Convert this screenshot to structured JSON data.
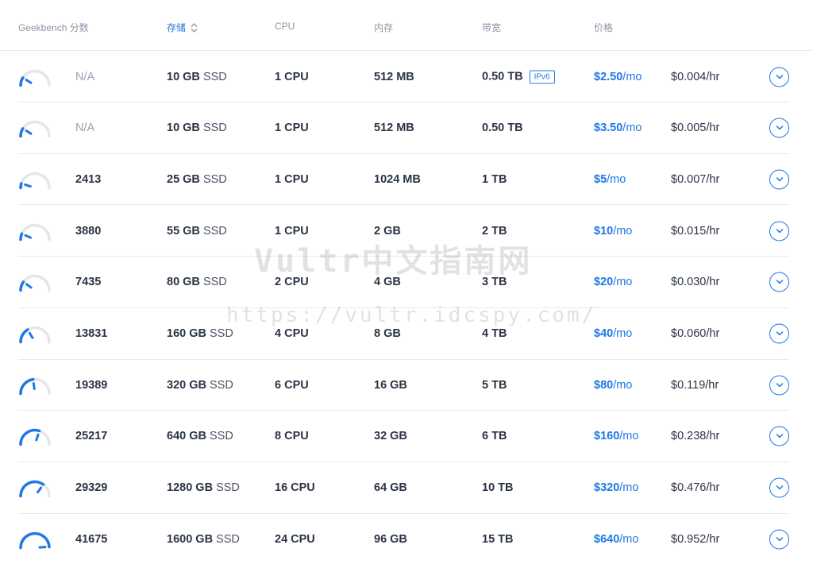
{
  "colors": {
    "accent": "#1e78e6",
    "text": "#2b3445",
    "muted": "#8a93a3",
    "gauge_track": "#e3e6eb"
  },
  "table": {
    "headers": {
      "geekbench": "Geekbench 分数",
      "storage": "存储",
      "cpu": "CPU",
      "memory": "内存",
      "bandwidth": "带宽",
      "price": "价格"
    },
    "sorted_column": "storage",
    "rows": [
      {
        "gauge_level": 0.18,
        "score": "N/A",
        "storage_num": "10 GB",
        "storage_unit": "SSD",
        "cpu": "1 CPU",
        "memory": "512 MB",
        "bandwidth": "0.50 TB",
        "tag": "IPv6",
        "price_value": "$2.50",
        "price_unit": "/mo",
        "hourly": "$0.004/hr"
      },
      {
        "gauge_level": 0.18,
        "score": "N/A",
        "storage_num": "10 GB",
        "storage_unit": "SSD",
        "cpu": "1 CPU",
        "memory": "512 MB",
        "bandwidth": "0.50 TB",
        "tag": "",
        "price_value": "$3.50",
        "price_unit": "/mo",
        "hourly": "$0.005/hr"
      },
      {
        "gauge_level": 0.1,
        "score": "2413",
        "storage_num": "25 GB",
        "storage_unit": "SSD",
        "cpu": "1 CPU",
        "memory": "1024 MB",
        "bandwidth": "1 TB",
        "tag": "",
        "price_value": "$5",
        "price_unit": "/mo",
        "hourly": "$0.007/hr"
      },
      {
        "gauge_level": 0.13,
        "score": "3880",
        "storage_num": "55 GB",
        "storage_unit": "SSD",
        "cpu": "1 CPU",
        "memory": "2 GB",
        "bandwidth": "2 TB",
        "tag": "",
        "price_value": "$10",
        "price_unit": "/mo",
        "hourly": "$0.015/hr"
      },
      {
        "gauge_level": 0.2,
        "score": "7435",
        "storage_num": "80 GB",
        "storage_unit": "SSD",
        "cpu": "2 CPU",
        "memory": "4 GB",
        "bandwidth": "3 TB",
        "tag": "",
        "price_value": "$20",
        "price_unit": "/mo",
        "hourly": "$0.030/hr"
      },
      {
        "gauge_level": 0.33,
        "score": "13831",
        "storage_num": "160 GB",
        "storage_unit": "SSD",
        "cpu": "4 CPU",
        "memory": "8 GB",
        "bandwidth": "4 TB",
        "tag": "",
        "price_value": "$40",
        "price_unit": "/mo",
        "hourly": "$0.060/hr"
      },
      {
        "gauge_level": 0.46,
        "score": "19389",
        "storage_num": "320 GB",
        "storage_unit": "SSD",
        "cpu": "6 CPU",
        "memory": "16 GB",
        "bandwidth": "5 TB",
        "tag": "",
        "price_value": "$80",
        "price_unit": "/mo",
        "hourly": "$0.119/hr"
      },
      {
        "gauge_level": 0.6,
        "score": "25217",
        "storage_num": "640 GB",
        "storage_unit": "SSD",
        "cpu": "8 CPU",
        "memory": "32 GB",
        "bandwidth": "6 TB",
        "tag": "",
        "price_value": "$160",
        "price_unit": "/mo",
        "hourly": "$0.238/hr"
      },
      {
        "gauge_level": 0.7,
        "score": "29329",
        "storage_num": "1280 GB",
        "storage_unit": "SSD",
        "cpu": "16 CPU",
        "memory": "64 GB",
        "bandwidth": "10 TB",
        "tag": "",
        "price_value": "$320",
        "price_unit": "/mo",
        "hourly": "$0.476/hr"
      },
      {
        "gauge_level": 0.98,
        "score": "41675",
        "storage_num": "1600 GB",
        "storage_unit": "SSD",
        "cpu": "24 CPU",
        "memory": "96 GB",
        "bandwidth": "15 TB",
        "tag": "",
        "price_value": "$640",
        "price_unit": "/mo",
        "hourly": "$0.952/hr"
      }
    ]
  },
  "watermark": {
    "title": "Vultr中文指南网",
    "url": "https://vultr.idcspy.com/"
  }
}
